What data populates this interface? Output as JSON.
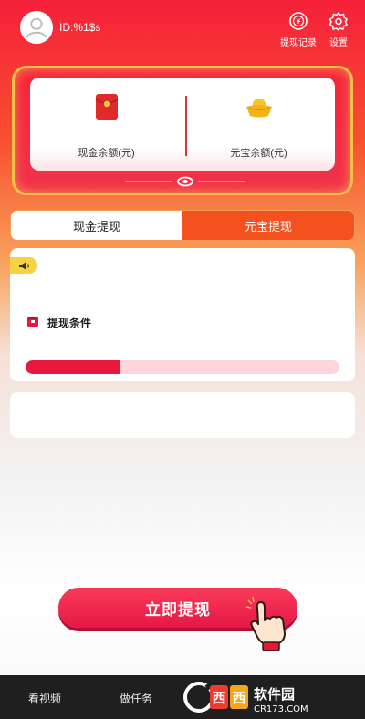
{
  "header": {
    "user_id": "ID:%1$s",
    "records_label": "提现记录",
    "settings_label": "设置"
  },
  "balance": {
    "cash_label": "现金余额(元)",
    "ingot_label": "元宝余额(元)"
  },
  "tabs": [
    {
      "label": "现金提现",
      "active": false
    },
    {
      "label": "元宝提现",
      "active": true
    }
  ],
  "conditions": {
    "title": "提现条件",
    "progress": 0.3
  },
  "withdraw": {
    "label": "立即提现"
  },
  "bottom_nav": [
    {
      "label": "看视频"
    },
    {
      "label": "做任务"
    }
  ],
  "watermark": {
    "brand": "西西软件园",
    "domain": "CR173.COM"
  },
  "colors": {
    "primary_red": "#e8183c",
    "active_tab": "#f4511e",
    "gold_border": "#f7c04a",
    "progress_track": "#fcd6dc"
  },
  "icons": [
    "avatar-icon",
    "record-coin-icon",
    "gear-icon",
    "red-envelope-icon",
    "gold-ingot-icon",
    "megaphone-icon",
    "gift-icon",
    "pointing-hand-icon"
  ]
}
